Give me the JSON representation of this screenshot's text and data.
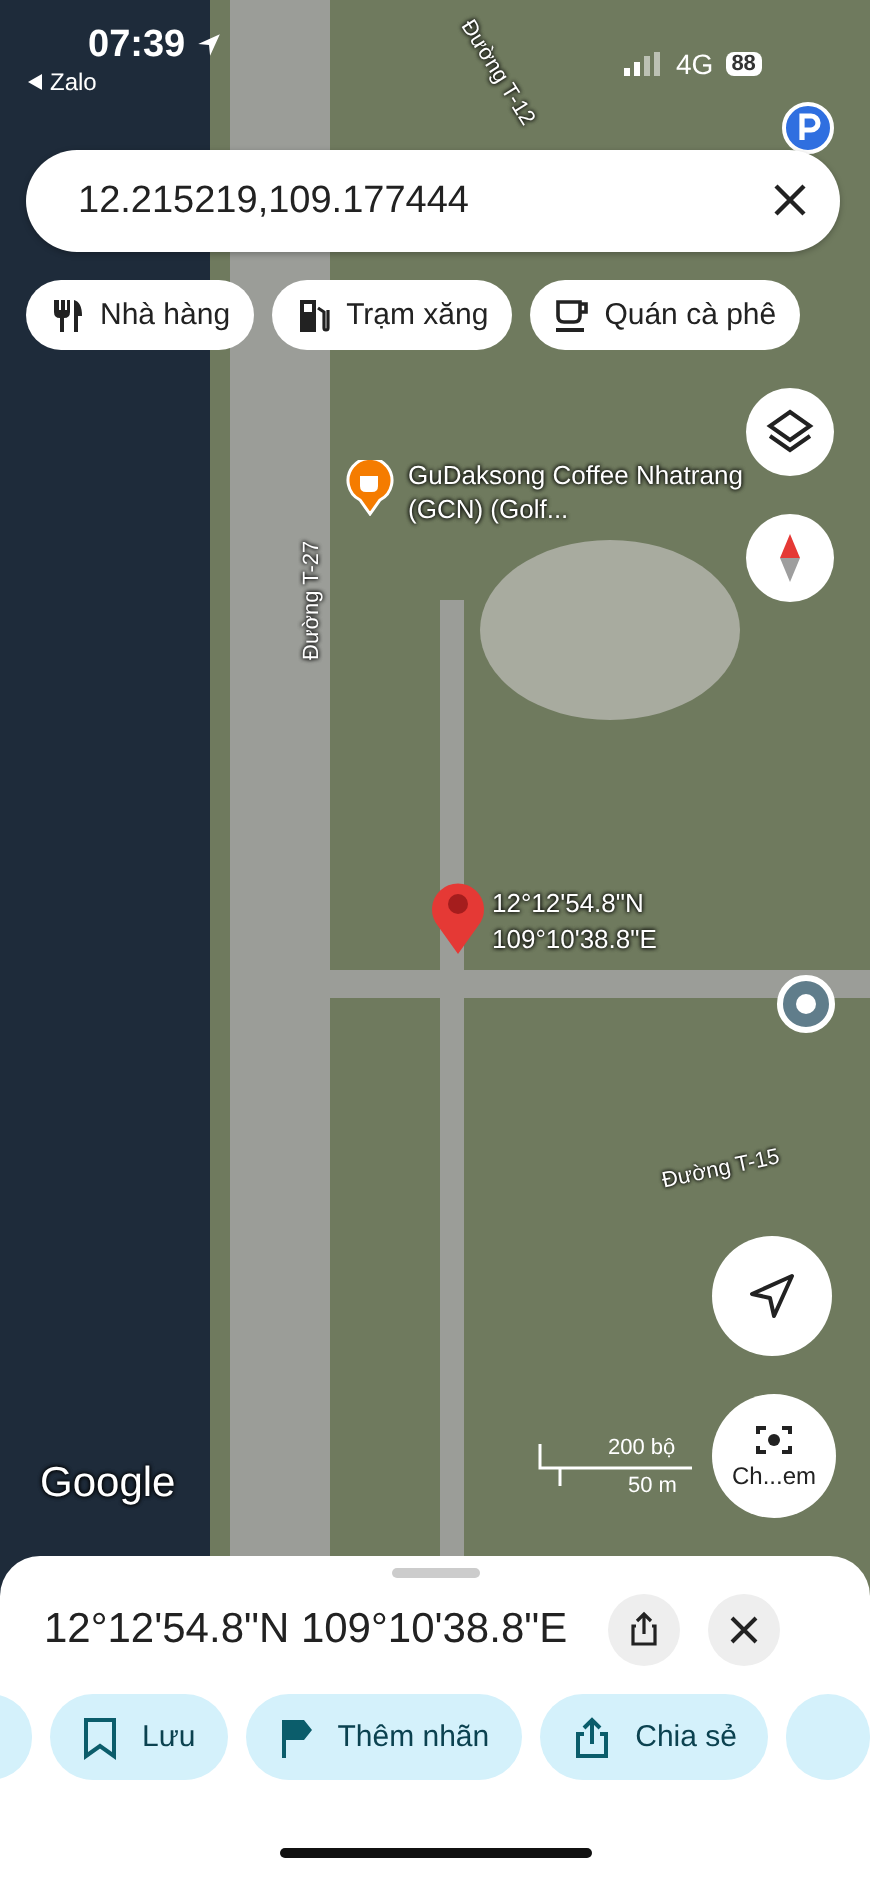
{
  "status_bar": {
    "time": "07:39",
    "back_app": "Zalo",
    "network": "4G",
    "battery": "88"
  },
  "search": {
    "value": "12.215219,109.177444"
  },
  "chips": [
    {
      "kind": "restaurant",
      "label": "Nhà hàng"
    },
    {
      "kind": "fuel",
      "label": "Trạm xăng"
    },
    {
      "kind": "coffee",
      "label": "Quán cà phê"
    }
  ],
  "map": {
    "place_label": "GuDaksong Coffee Nhatrang (GCN) (Golf...",
    "streets": [
      "Đường T-27",
      "Đường T-12",
      "Đường T-15"
    ],
    "pin_label": [
      "12°12'54.8\"N",
      "109°10'38.8\"E"
    ],
    "scale": [
      "200 bộ",
      "50 m"
    ],
    "logo": "Google",
    "camera_label": "Ch...em"
  },
  "sheet": {
    "title": "12°12'54.8\"N 109°10'38.8\"E",
    "actions": [
      {
        "kind": "save",
        "label": "Lưu"
      },
      {
        "kind": "label",
        "label": "Thêm nhãn"
      },
      {
        "kind": "share",
        "label": "Chia sẻ"
      }
    ]
  }
}
